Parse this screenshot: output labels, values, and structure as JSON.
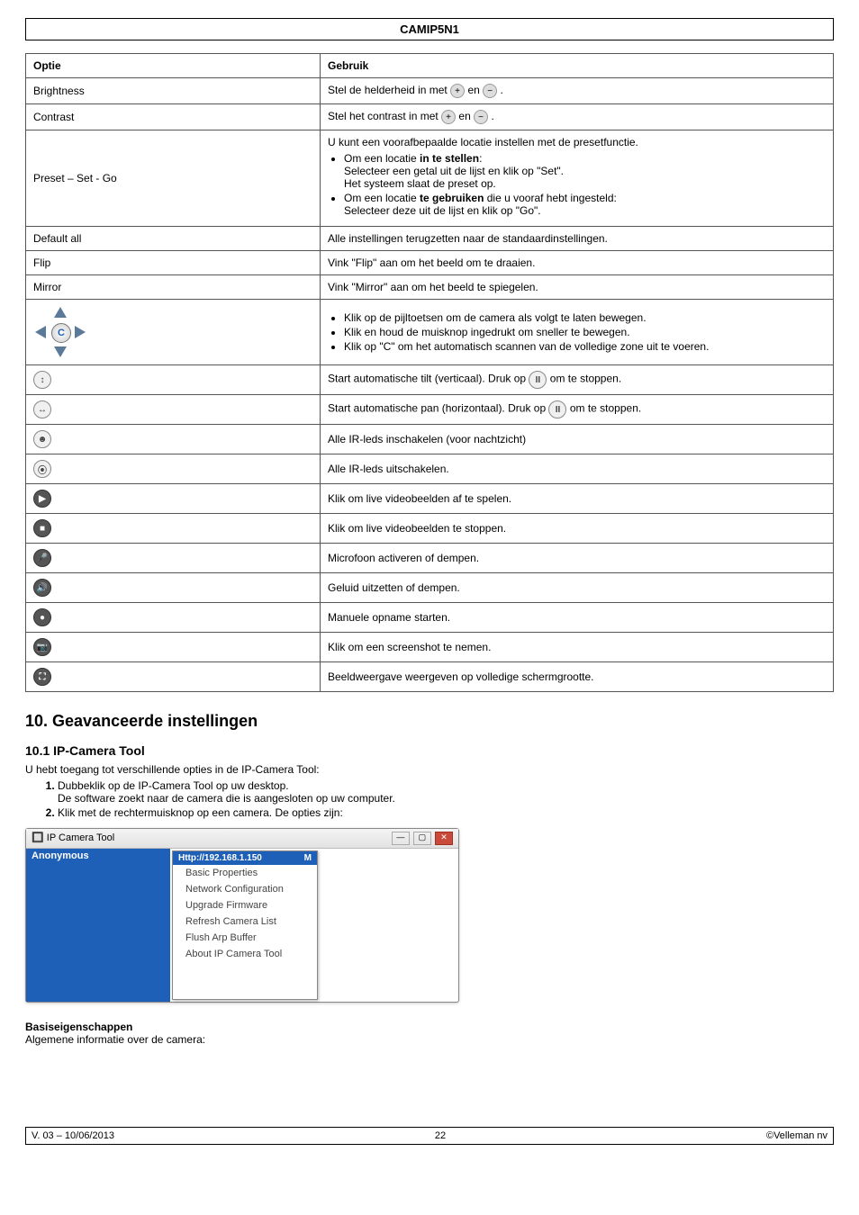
{
  "header": "CAMIP5N1",
  "table": {
    "head": {
      "left": "Optie",
      "right": "Gebruik"
    },
    "rows": {
      "brightness_label": "Brightness",
      "brightness_text_a": "Stel de helderheid in met ",
      "brightness_text_b": " en ",
      "brightness_text_c": ".",
      "contrast_label": "Contrast",
      "contrast_text_a": "Stel het contrast in met ",
      "contrast_text_b": " en ",
      "contrast_text_c": ".",
      "preset_label": "Preset – Set - Go",
      "preset_intro": "U kunt een voorafbepaalde locatie instellen met de presetfunctie.",
      "preset_b1_a": "Om een locatie ",
      "preset_b1_bold": "in te stellen",
      "preset_b1_b": ":",
      "preset_b1_line2": "Selecteer een getal uit de lijst en klik op \"Set\".",
      "preset_b1_line3": "Het systeem slaat de preset op.",
      "preset_b2_a": "Om een locatie ",
      "preset_b2_bold": "te gebruiken",
      "preset_b2_b": " die u vooraf hebt ingesteld:",
      "preset_b2_line2": "Selecteer deze uit de lijst en klik op \"Go\".",
      "default_all_label": "Default all",
      "default_all_text": "Alle instellingen terugzetten naar de standaardinstellingen.",
      "flip_label": "Flip",
      "flip_text": "Vink \"Flip\" aan om het beeld om te draaien.",
      "mirror_label": "Mirror",
      "mirror_text": "Vink \"Mirror\" aan om het beeld te spiegelen.",
      "nav_center": "C",
      "nav_b1": "Klik op de pijltoetsen om de camera als volgt te laten bewegen.",
      "nav_b2": "Klik en houd de muisknop ingedrukt om sneller te bewegen.",
      "nav_b3": "Klik op \"C\" om het automatisch scannen van de volledige zone uit te voeren.",
      "tilt_text_a": "Start automatische tilt (verticaal). Druk op ",
      "tilt_text_b": " om te stoppen.",
      "pan_text_a": "Start automatische pan (horizontaal). Druk op ",
      "pan_text_b": " om te stoppen.",
      "ir_on_text": "Alle IR-leds inschakelen (voor nachtzicht)",
      "ir_off_text": "Alle IR-leds uitschakelen.",
      "play_text": "Klik om live videobeelden af te spelen.",
      "stop_text": "Klik om live videobeelden te stoppen.",
      "mic_text": "Microfoon activeren of dempen.",
      "sound_text": "Geluid uitzetten of dempen.",
      "record_text": "Manuele opname starten.",
      "screenshot_text": "Klik om een screenshot te nemen.",
      "fullscreen_text": "Beeldweergave weergeven op volledige schermgrootte."
    },
    "glyphs": {
      "plus": "+",
      "minus": "−",
      "tilt": "↕",
      "pan": "↔",
      "pause": "II",
      "iron": "☻",
      "iroff": "⦿",
      "play": "▶",
      "stop": "■",
      "mic": "🎤",
      "sound": "🔊",
      "record": "●",
      "screenshot": "📷",
      "fullscreen": "⛶"
    }
  },
  "section_title": "10.   Geavanceerde instellingen",
  "subsection_title": "10.1  IP-Camera Tool",
  "intro_text": "U hebt toegang tot verschillende opties in de IP-Camera Tool:",
  "step1_a": "Dubbeklik op de IP-Camera Tool op uw desktop.",
  "step1_b": "De software zoekt naar de camera die is aangesloten op uw computer.",
  "step2": "Klik met de rechtermuisknop op een camera. De opties zijn:",
  "app": {
    "title": "IP Camera Tool",
    "list_item": "Anonymous",
    "menu_header": "Http://192.168.1.150",
    "menu_header_right": "M",
    "items": [
      "Basic Properties",
      "Network Configuration",
      "Upgrade Firmware",
      "Refresh Camera List",
      "Flush Arp Buffer",
      "About IP Camera Tool"
    ]
  },
  "basis_title": "Basiseigenschappen",
  "basis_text": "Algemene informatie over de camera:",
  "footer": {
    "left": "V. 03 – 10/06/2013",
    "center": "22",
    "right": "©Velleman nv"
  }
}
